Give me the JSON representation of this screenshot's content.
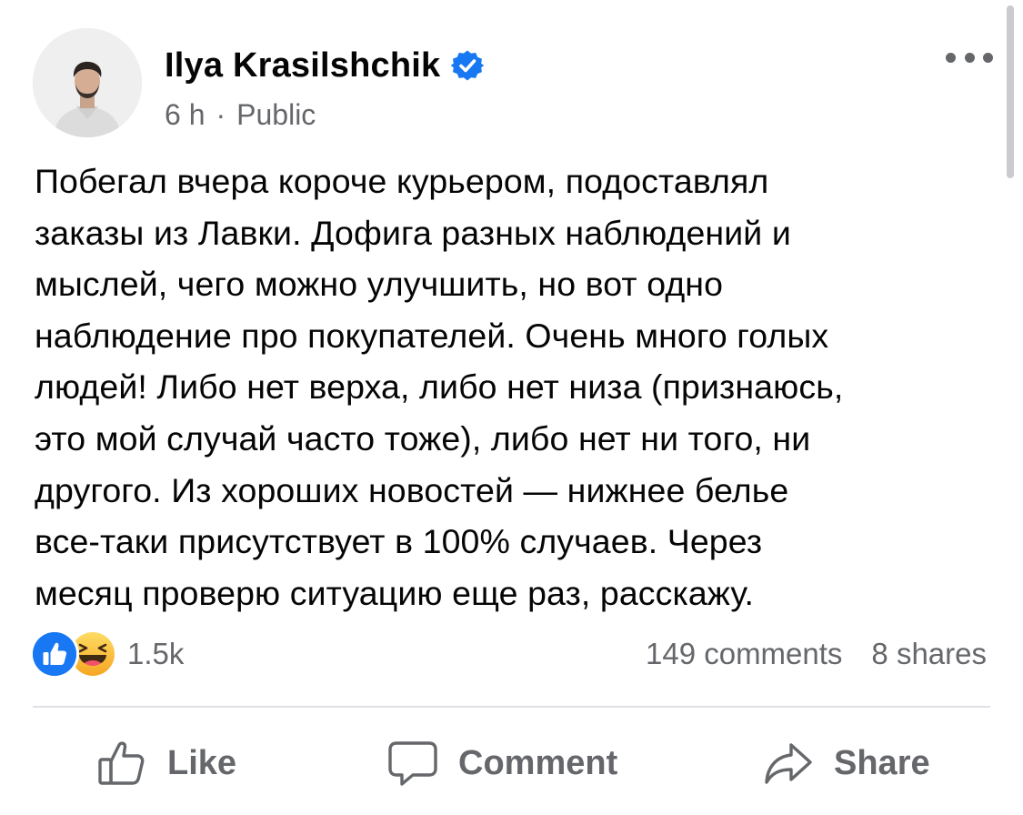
{
  "post": {
    "author": "Ilya Krasilshchik",
    "time": "6 h",
    "separator": "·",
    "audience": "Public",
    "text_lines": [
      "Побегал вчера короче курьером, подоставлял",
      "заказы из Лавки. Дофига разных наблюдений и",
      "мыслей, чего можно улучшить, но вот одно",
      "наблюдение про покупателей. Очень много голых",
      "людей! Либо нет верха, либо нет низа (признаюсь,",
      "это мой случай часто тоже), либо нет ни того, ни",
      "другого. Из хороших новостей — нижнее белье",
      "все-таки присутствует в 100% случаев. Через",
      "месяц проверю ситуацию еще раз, расскажу."
    ]
  },
  "stats": {
    "reactions": "1.5k",
    "comments": "149 comments",
    "shares": "8 shares"
  },
  "actions": {
    "like": "Like",
    "comment": "Comment",
    "share": "Share"
  },
  "icons": {
    "verified": "verified-badge-icon",
    "more": "more-options-icon",
    "like_reaction": "like-reaction-icon",
    "haha_reaction": "haha-reaction-icon",
    "like": "thumbs-up-icon",
    "comment": "comment-bubble-icon",
    "share": "share-arrow-icon"
  },
  "colors": {
    "accent": "#1877f2",
    "secondary_text": "#65676b",
    "primary_text": "#050505",
    "divider": "#dfe1e5"
  }
}
